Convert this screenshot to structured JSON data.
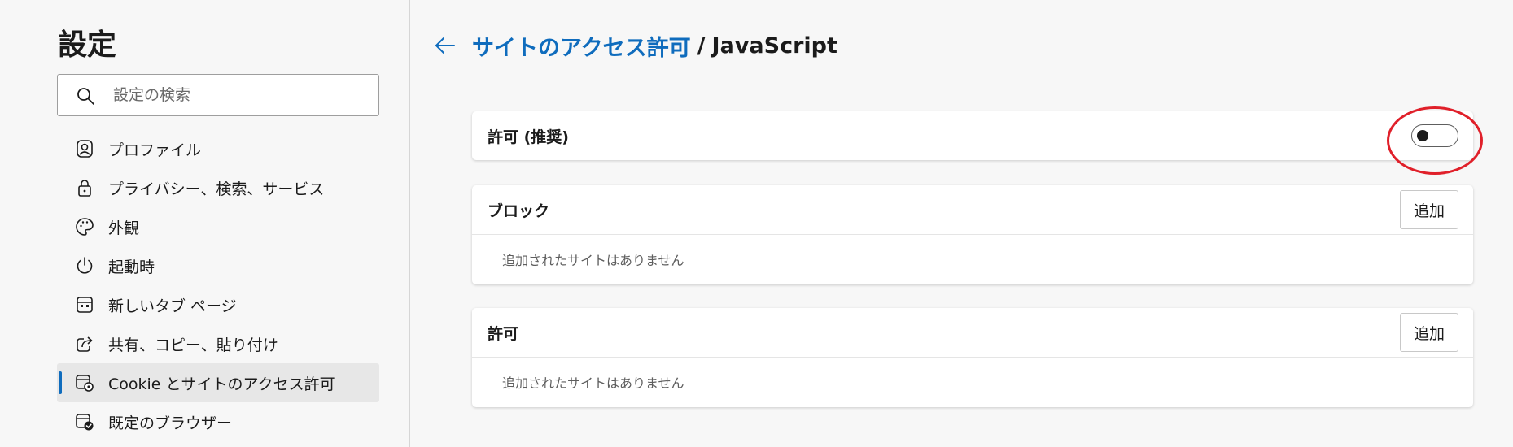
{
  "sidebar": {
    "title": "設定",
    "search": {
      "placeholder": "設定の検索",
      "value": ""
    },
    "items": [
      {
        "label": "プロファイル",
        "icon": "profile-icon"
      },
      {
        "label": "プライバシー、検索、サービス",
        "icon": "lock-icon"
      },
      {
        "label": "外観",
        "icon": "palette-icon"
      },
      {
        "label": "起動時",
        "icon": "power-icon"
      },
      {
        "label": "新しいタブ ページ",
        "icon": "new-tab-page-icon"
      },
      {
        "label": "共有、コピー、貼り付け",
        "icon": "share-icon"
      },
      {
        "label": "Cookie とサイトのアクセス許可",
        "icon": "cookie-permissions-icon",
        "active": true
      },
      {
        "label": "既定のブラウザー",
        "icon": "default-browser-icon"
      }
    ]
  },
  "header": {
    "breadcrumb_parent": "サイトのアクセス許可",
    "separator": "/",
    "breadcrumb_current": "JavaScript"
  },
  "allow_recommended": {
    "label": "許可 (推奨)",
    "enabled": false
  },
  "block_section": {
    "title": "ブロック",
    "add_label": "追加",
    "empty_text": "追加されたサイトはありません"
  },
  "allow_section": {
    "title": "許可",
    "add_label": "追加",
    "empty_text": "追加されたサイトはありません"
  },
  "colors": {
    "accent": "#0f6cbd",
    "annotation": "#e0202a",
    "background": "#f7f7f7"
  }
}
